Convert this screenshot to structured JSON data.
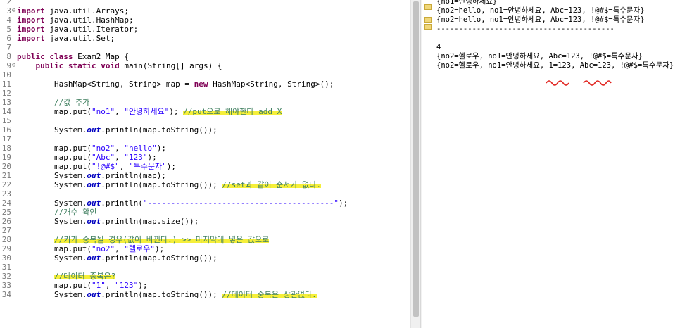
{
  "editor": {
    "lines": [
      {
        "num": "2",
        "fold": "",
        "parts": []
      },
      {
        "num": "3",
        "fold": "⊖",
        "parts": [
          {
            "k": "kw",
            "t": "import"
          },
          {
            "k": "",
            "t": " java.util.Arrays;"
          }
        ]
      },
      {
        "num": "4",
        "fold": "",
        "parts": [
          {
            "k": "kw",
            "t": "import"
          },
          {
            "k": "",
            "t": " java.util.HashMap;"
          }
        ]
      },
      {
        "num": "5",
        "fold": "",
        "parts": [
          {
            "k": "kw",
            "t": "import"
          },
          {
            "k": "",
            "t": " java.util.Iterator;"
          }
        ]
      },
      {
        "num": "6",
        "fold": "",
        "parts": [
          {
            "k": "kw",
            "t": "import"
          },
          {
            "k": "",
            "t": " java.util.Set;"
          }
        ]
      },
      {
        "num": "7",
        "fold": "",
        "parts": []
      },
      {
        "num": "8",
        "fold": "",
        "parts": [
          {
            "k": "kw",
            "t": "public"
          },
          {
            "k": "",
            "t": " "
          },
          {
            "k": "kw",
            "t": "class"
          },
          {
            "k": "",
            "t": " Exam2_Map {"
          }
        ]
      },
      {
        "num": "9",
        "fold": "⊖",
        "parts": [
          {
            "k": "",
            "t": "    "
          },
          {
            "k": "kw",
            "t": "public"
          },
          {
            "k": "",
            "t": " "
          },
          {
            "k": "kw",
            "t": "static"
          },
          {
            "k": "",
            "t": " "
          },
          {
            "k": "kw",
            "t": "void"
          },
          {
            "k": "",
            "t": " main(String[] args) {"
          }
        ]
      },
      {
        "num": "10",
        "fold": "",
        "parts": []
      },
      {
        "num": "11",
        "fold": "",
        "parts": [
          {
            "k": "",
            "t": "        HashMap<String, String> map = "
          },
          {
            "k": "kw",
            "t": "new"
          },
          {
            "k": "",
            "t": " HashMap<String, String>();"
          }
        ]
      },
      {
        "num": "12",
        "fold": "",
        "parts": []
      },
      {
        "num": "13",
        "fold": "",
        "parts": [
          {
            "k": "cm",
            "t": "        //값 추가"
          }
        ]
      },
      {
        "num": "14",
        "fold": "",
        "parts": [
          {
            "k": "",
            "t": "        map.put("
          },
          {
            "k": "str",
            "t": "\"no1\""
          },
          {
            "k": "",
            "t": ", "
          },
          {
            "k": "str",
            "t": "\"안녕하세요\""
          },
          {
            "k": "",
            "t": "); "
          },
          {
            "k": "cm hl",
            "t": "//put으로 해야한다 add X"
          }
        ]
      },
      {
        "num": "15",
        "fold": "",
        "parts": []
      },
      {
        "num": "16",
        "fold": "",
        "parts": [
          {
            "k": "",
            "t": "        System."
          },
          {
            "k": "fld",
            "t": "out"
          },
          {
            "k": "",
            "t": ".println(map.toString());"
          }
        ]
      },
      {
        "num": "17",
        "fold": "",
        "parts": []
      },
      {
        "num": "18",
        "fold": "",
        "parts": [
          {
            "k": "",
            "t": "        map.put("
          },
          {
            "k": "str",
            "t": "\"no2\""
          },
          {
            "k": "",
            "t": ", "
          },
          {
            "k": "str",
            "t": "\"hello\""
          },
          {
            "k": "",
            "t": ");"
          }
        ]
      },
      {
        "num": "19",
        "fold": "",
        "parts": [
          {
            "k": "",
            "t": "        map.put("
          },
          {
            "k": "str",
            "t": "\"Abc\""
          },
          {
            "k": "",
            "t": ", "
          },
          {
            "k": "str",
            "t": "\"123\""
          },
          {
            "k": "",
            "t": ");"
          }
        ]
      },
      {
        "num": "20",
        "fold": "",
        "parts": [
          {
            "k": "",
            "t": "        map.put("
          },
          {
            "k": "str",
            "t": "\"!@#$\""
          },
          {
            "k": "",
            "t": ", "
          },
          {
            "k": "str",
            "t": "\"특수문자\""
          },
          {
            "k": "",
            "t": ");"
          }
        ]
      },
      {
        "num": "21",
        "fold": "",
        "parts": [
          {
            "k": "",
            "t": "        System."
          },
          {
            "k": "fld",
            "t": "out"
          },
          {
            "k": "",
            "t": ".println(map);"
          }
        ]
      },
      {
        "num": "22",
        "fold": "",
        "parts": [
          {
            "k": "",
            "t": "        System."
          },
          {
            "k": "fld",
            "t": "out"
          },
          {
            "k": "",
            "t": ".println(map.toString()); "
          },
          {
            "k": "cm hl",
            "t": "//set과 같이 순서가 없다."
          }
        ]
      },
      {
        "num": "23",
        "fold": "",
        "parts": []
      },
      {
        "num": "24",
        "fold": "",
        "parts": [
          {
            "k": "",
            "t": "        System."
          },
          {
            "k": "fld",
            "t": "out"
          },
          {
            "k": "",
            "t": ".println("
          },
          {
            "k": "str",
            "t": "\"----------------------------------------\""
          },
          {
            "k": "",
            "t": ");"
          }
        ]
      },
      {
        "num": "25",
        "fold": "",
        "parts": [
          {
            "k": "cm",
            "t": "        //개수 확인"
          }
        ]
      },
      {
        "num": "26",
        "fold": "",
        "parts": [
          {
            "k": "",
            "t": "        System."
          },
          {
            "k": "fld",
            "t": "out"
          },
          {
            "k": "",
            "t": ".println(map.size());"
          }
        ]
      },
      {
        "num": "27",
        "fold": "",
        "parts": []
      },
      {
        "num": "28",
        "fold": "",
        "parts": [
          {
            "k": "",
            "t": "        "
          },
          {
            "k": "cm hl",
            "t": "//키가 중복될 경우(값이 바뀐다.) >> 마지막에 넣은 값으로"
          }
        ]
      },
      {
        "num": "29",
        "fold": "",
        "parts": [
          {
            "k": "",
            "t": "        map.put("
          },
          {
            "k": "str",
            "t": "\"no2\""
          },
          {
            "k": "",
            "t": ", "
          },
          {
            "k": "str",
            "t": "\"헬로우\""
          },
          {
            "k": "",
            "t": ");"
          }
        ]
      },
      {
        "num": "30",
        "fold": "",
        "parts": [
          {
            "k": "",
            "t": "        System."
          },
          {
            "k": "fld",
            "t": "out"
          },
          {
            "k": "",
            "t": ".println(map.toString());"
          }
        ]
      },
      {
        "num": "31",
        "fold": "",
        "parts": []
      },
      {
        "num": "32",
        "fold": "",
        "parts": [
          {
            "k": "",
            "t": "        "
          },
          {
            "k": "cm hl",
            "t": "//데이터 중복은?"
          }
        ]
      },
      {
        "num": "33",
        "fold": "",
        "parts": [
          {
            "k": "",
            "t": "        map.put("
          },
          {
            "k": "str",
            "t": "\"1\""
          },
          {
            "k": "",
            "t": ", "
          },
          {
            "k": "str",
            "t": "\"123\""
          },
          {
            "k": "",
            "t": ");"
          }
        ]
      },
      {
        "num": "34",
        "fold": "",
        "parts": [
          {
            "k": "",
            "t": "        System."
          },
          {
            "k": "fld",
            "t": "out"
          },
          {
            "k": "",
            "t": ".println(map.toString()); "
          },
          {
            "k": "cm hl",
            "t": "//데이터 중복은 상관없다."
          }
        ]
      }
    ]
  },
  "console": {
    "lines": [
      "{no1=안녕하세요}",
      "{no2=hello, no1=안녕하세요, Abc=123, !@#$=특수문자}",
      "{no2=hello, no1=안녕하세요, Abc=123, !@#$=특수문자}",
      "----------------------------------------",
      "",
      "4",
      "{no2=헬로우, no1=안녕하세요, Abc=123, !@#$=특수문자}",
      "{no2=헬로우, no1=안녕하세요, 1=123, Abc=123, !@#$=특수문자}"
    ]
  },
  "colors": {
    "keyword": "#7f0055",
    "string": "#2a00ff",
    "comment": "#3f7f5f",
    "field": "#0000c0",
    "highlight": "#f5ef3a",
    "annotation": "#e0201b"
  }
}
